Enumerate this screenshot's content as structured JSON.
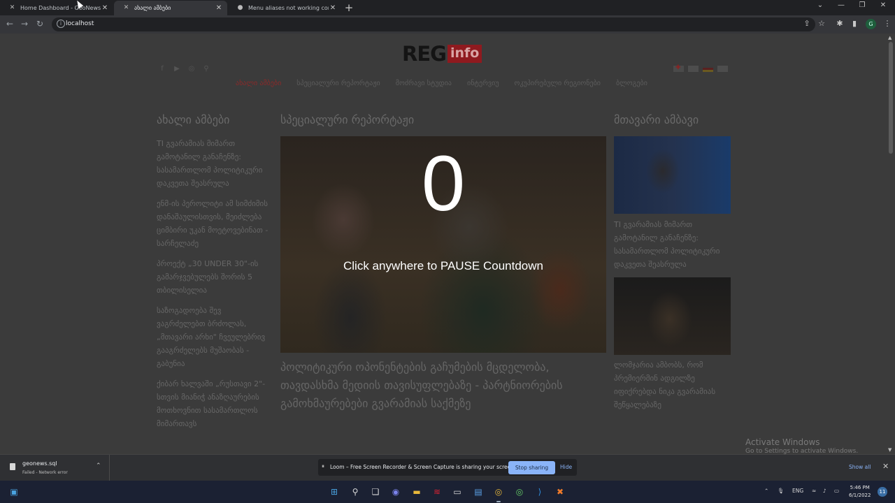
{
  "browser": {
    "tabs": [
      {
        "title": "Home Dashboard - GeoNews - Ad",
        "icon": "x-icon"
      },
      {
        "title": "ახალი ამბები",
        "icon": "x-icon"
      },
      {
        "title": "Menu aliases not working correc",
        "icon": "github-icon"
      }
    ],
    "url": "localhost",
    "profile_initial": "G"
  },
  "site": {
    "logo_main": "REG",
    "logo_badge": "info",
    "menu": [
      "ახალი ამბები",
      "სპეციალური რეპორტაჟი",
      "მოძრავი სტუდია",
      "ინტერვიუ",
      "ოკუპირებული რეგიონები",
      "ბლოგები"
    ],
    "columns": {
      "left_title": "ახალი ამბები",
      "center_title": "სპეციალური რეპორტაჟი",
      "right_title": "მთავარი ამბავი"
    },
    "left_news": [
      "TI გვარამიას მიმართ გამოტანილ განაჩენზე: სასამართლომ პოლიტიკური დაკვეთა შეასრულა",
      "ენმ-ის პეროლიტი ამ სიმძიმის დანაშაულისთვის, მეიძლება ციმბირი უკან მოეტოვებინათ - სარჩელაძე",
      "პროექტ „30 UNDER 30\"-ის გამარჯვებულებს შორის 5 თბილისელია",
      "საზოგადოება შევ ვაგრძელებთ ბრძოლას, „მთავარი არხი\" ჩვეულებრივ გააგრძელებს მუშაობას - გაბუნია",
      "ქიბარ ხალვაში „რუსთავი 2\"-სთვის მიანიჭ ანაზღაურების მოთხოვნით სასამართლოს მიმართავს"
    ],
    "countdown_value": "0",
    "countdown_message": "Click anywhere to PAUSE Countdown",
    "center_headline": "პოლიტიკური ოპონენტების გაჩუმების მცდელობა, თავდასხმა მედიის თავისუფლებაზე - პარტნიორების გამოხმაურებები გვარამიას საქმეზე",
    "right_captions": [
      "TI გვარამიას მიმართ გამოტანილ განაჩენზე: სასამართლომ პოლიტიკური დაკვეთა შეასრულა",
      "ლომჯარია ამბობს, რომ პრემიერმინ ადგილზე იფიქრებდა ნიკა გვარამიას შეწყალებაზე"
    ],
    "watermark_title": "Activate Windows",
    "watermark_sub": "Go to Settings to activate Windows."
  },
  "download_bar": {
    "file_name": "geonews.sql",
    "status": "Failed - Network error",
    "loom_message": "Loom – Free Screen Recorder & Screen Capture is sharing your screen.",
    "stop_label": "Stop sharing",
    "hide_label": "Hide",
    "show_all": "Show all"
  },
  "taskbar": {
    "language": "ENG",
    "time": "5:46 PM",
    "date": "6/1/2022",
    "notifications": "11"
  }
}
